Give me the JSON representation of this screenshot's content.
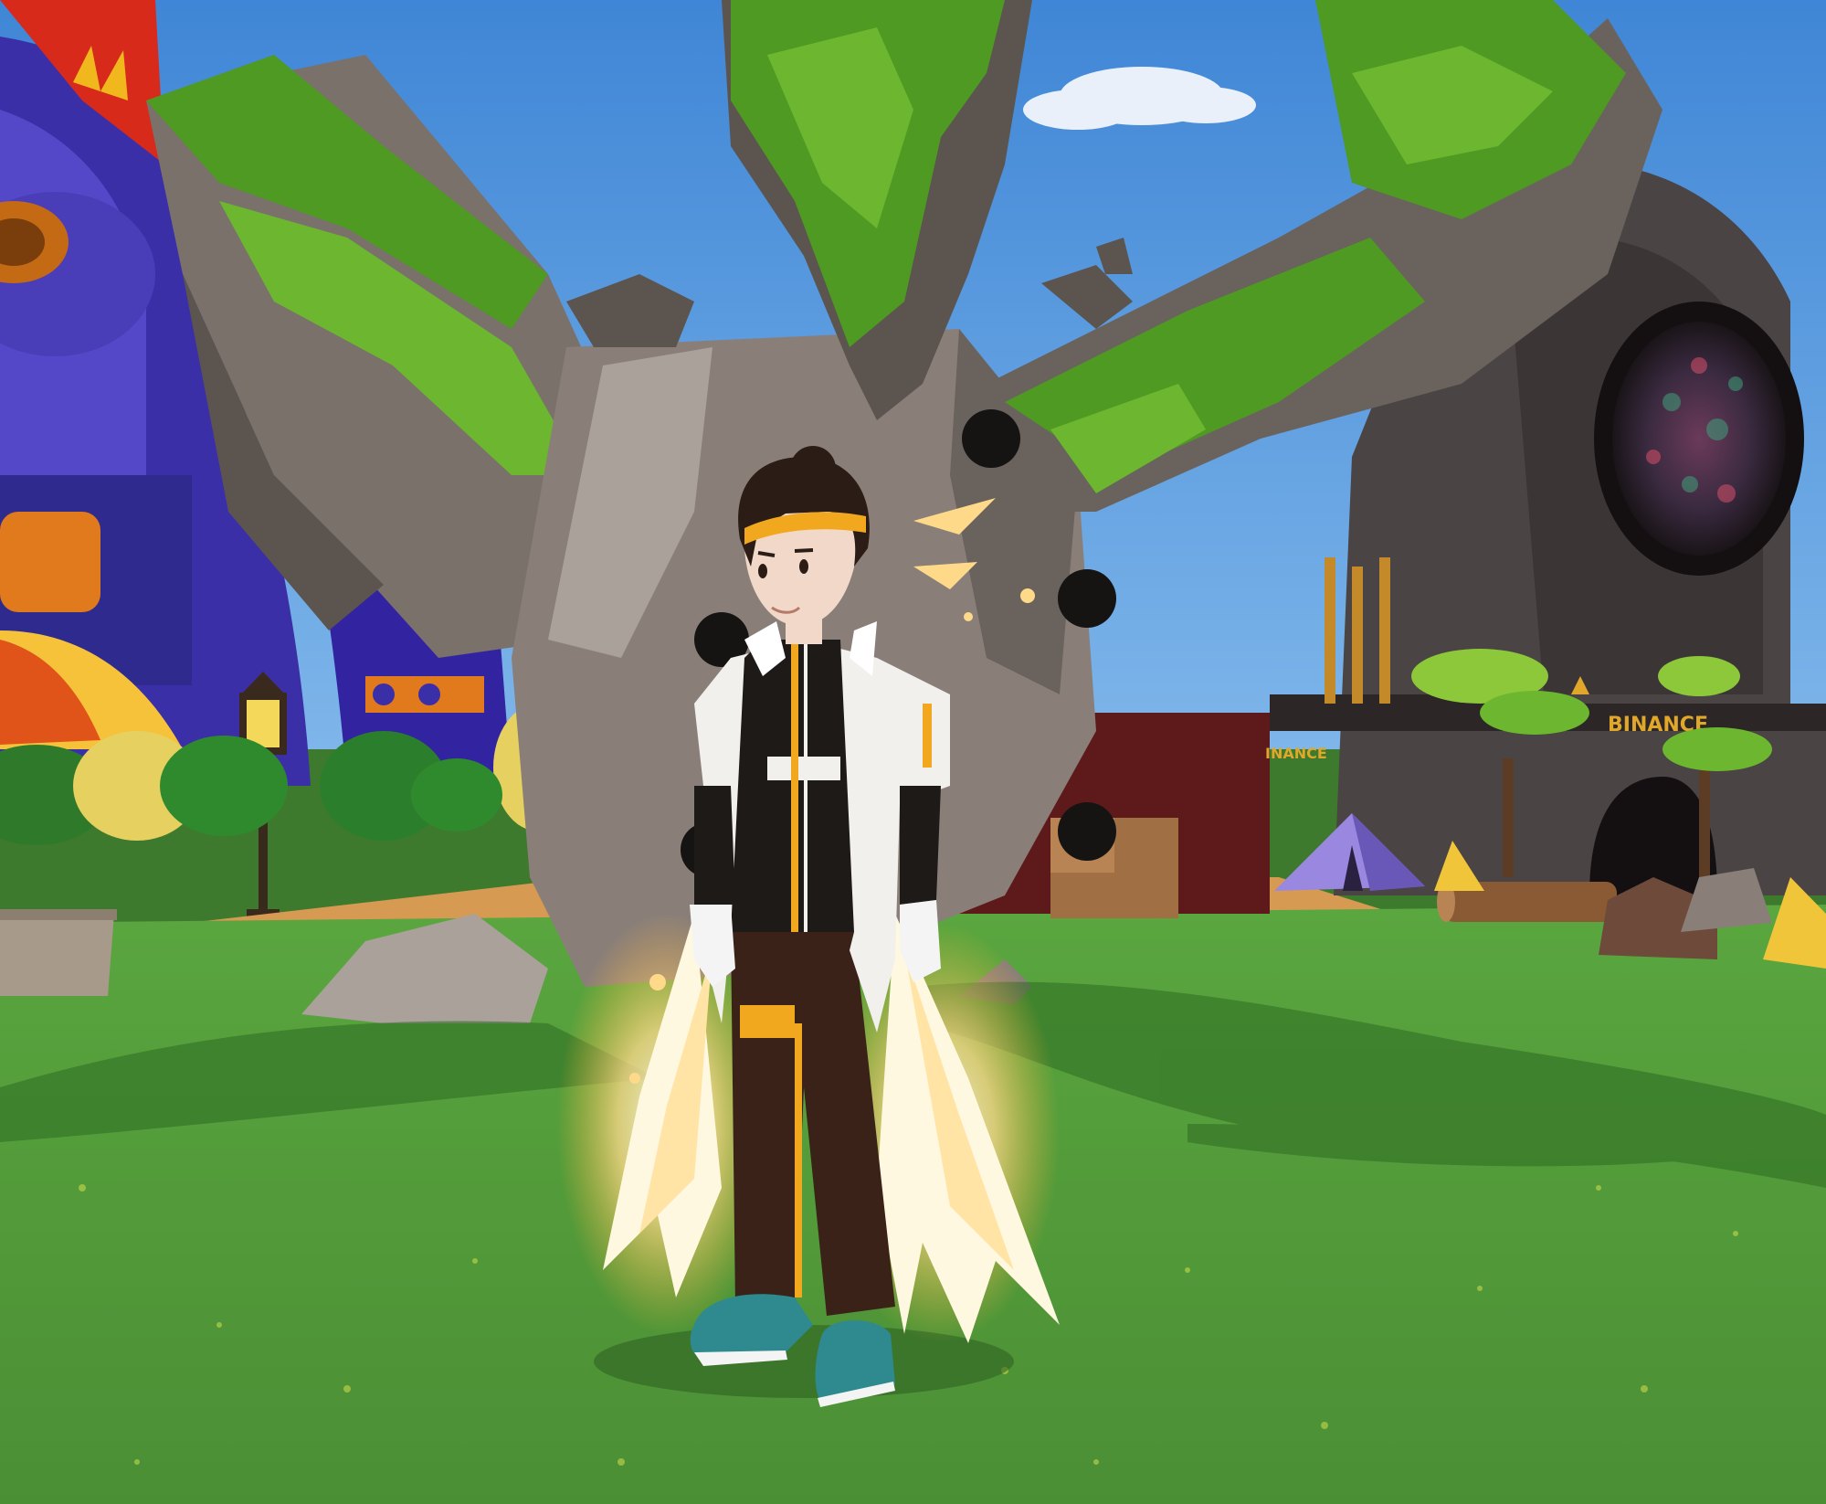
{
  "scene": {
    "sky_top_color": "#3f86d6",
    "sky_bottom_color": "#8cc0ee",
    "grass_color": "#4f9a3a",
    "grass_dark_color": "#3f7f2c",
    "path_color": "#d79a52",
    "rock_color": "#8a7f78",
    "rock_dark_color": "#5c554f",
    "moss_color": "#4f9a22",
    "moss_light_color": "#6cb72f",
    "tower_color": "#4a4444",
    "purple_color": "#3b2fa8",
    "glow_color": "#ffd98a"
  },
  "signs": {
    "tower_sign": "BINANCE",
    "hut_sign": "INANCE"
  },
  "avatar": {
    "jacket_color": "#f2f0ec",
    "inner_color": "#1e1a18",
    "accent_color": "#f2a81e",
    "pants_color": "#3a2218",
    "shoe_color": "#2e8a8e",
    "skin_color": "#f1d8c8",
    "hair_color": "#2b1d16"
  }
}
